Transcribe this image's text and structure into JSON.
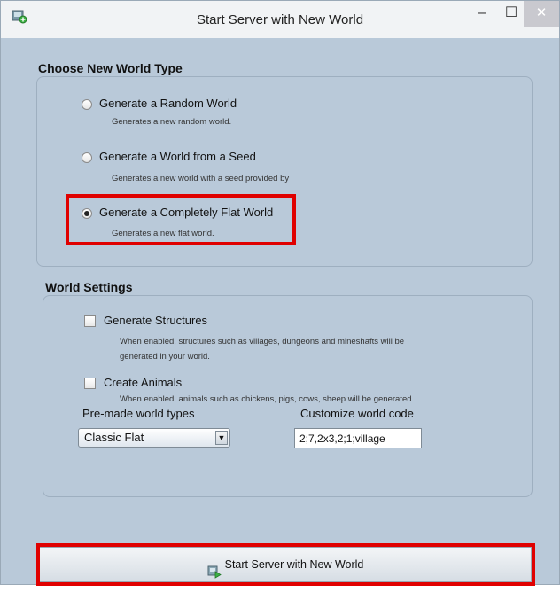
{
  "window": {
    "title": "Start Server with New World",
    "minimize_glyph": "–",
    "maximize_glyph": "☐",
    "close_glyph": "✕"
  },
  "world_type": {
    "heading": "Choose New World Type",
    "options": [
      {
        "label": "Generate a Random World",
        "description": "Generates a new random world.",
        "selected": false
      },
      {
        "label": "Generate a World from a Seed",
        "description": "Generates a new world with a seed provided by",
        "selected": false
      },
      {
        "label": "Generate a Completely Flat World",
        "description": "Generates a new flat world.",
        "selected": true
      }
    ]
  },
  "world_settings": {
    "heading": "World Settings",
    "generate_structures": {
      "label": "Generate Structures",
      "checked": false,
      "description_line1": "When enabled, structures such as villages, dungeons and mineshafts will be",
      "description_line2": "generated in your world."
    },
    "create_animals": {
      "label": "Create Animals",
      "checked": false,
      "description": "When enabled, animals such as chickens, pigs, cows, sheep will be generated"
    },
    "premade_label": "Pre-made world types",
    "premade_selected": "Classic Flat",
    "customize_label": "Customize world code",
    "customize_value": "2;7,2x3,2;1;village"
  },
  "start_button": {
    "label": "Start Server with New World",
    "icon": "server-start-icon"
  },
  "colors": {
    "background": "#b9c9d9",
    "highlight": "#e00000"
  }
}
